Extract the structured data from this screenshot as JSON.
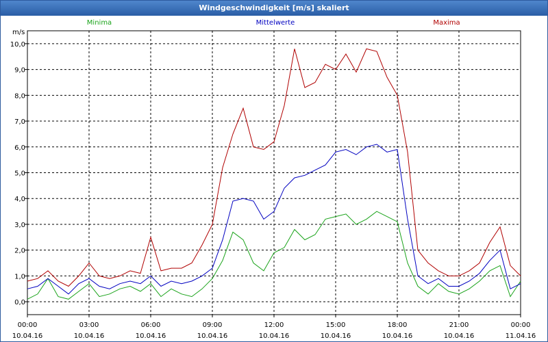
{
  "window": {
    "title": "Windgeschwindigkeit [m/s] skaliert"
  },
  "chart_data": {
    "type": "line",
    "title": "Windgeschwindigkeit [m/s] skaliert",
    "ylabel": "m/s",
    "xlabel": "",
    "ylim": [
      -0.5,
      10.5
    ],
    "xlim": [
      0,
      24
    ],
    "grid": true,
    "legend_placement": "top",
    "yticks": [
      {
        "value": 0,
        "label": "0,0"
      },
      {
        "value": 1,
        "label": "1,0"
      },
      {
        "value": 2,
        "label": "2,0"
      },
      {
        "value": 3,
        "label": "3,0"
      },
      {
        "value": 4,
        "label": "4,0"
      },
      {
        "value": 5,
        "label": "5,0"
      },
      {
        "value": 6,
        "label": "6,0"
      },
      {
        "value": 7,
        "label": "7,0"
      },
      {
        "value": 8,
        "label": "8,0"
      },
      {
        "value": 9,
        "label": "9,0"
      },
      {
        "value": 10,
        "label": "10,0"
      }
    ],
    "xticks": [
      {
        "value": 0,
        "time": "00:00",
        "date": "10.04.16"
      },
      {
        "value": 3,
        "time": "03:00",
        "date": "10.04.16"
      },
      {
        "value": 6,
        "time": "06:00",
        "date": "10.04.16"
      },
      {
        "value": 9,
        "time": "09:00",
        "date": "10.04.16"
      },
      {
        "value": 12,
        "time": "12:00",
        "date": "10.04.16"
      },
      {
        "value": 15,
        "time": "15:00",
        "date": "10.04.16"
      },
      {
        "value": 18,
        "time": "18:00",
        "date": "10.04.16"
      },
      {
        "value": 21,
        "time": "21:00",
        "date": "10.04.16"
      },
      {
        "value": 24,
        "time": "00:00",
        "date": "11.04.16"
      }
    ],
    "series": [
      {
        "name": "Minima",
        "color": "#1aa31a",
        "x": [
          0,
          0.5,
          1,
          1.5,
          2,
          2.5,
          3,
          3.5,
          4,
          4.5,
          5,
          5.5,
          6,
          6.5,
          7,
          7.5,
          8,
          8.5,
          9,
          9.5,
          10,
          10.5,
          11,
          11.5,
          12,
          12.5,
          13,
          13.5,
          14,
          14.5,
          15,
          15.5,
          16,
          16.5,
          17,
          17.5,
          18,
          18.5,
          19,
          19.5,
          20,
          20.5,
          21,
          21.5,
          22,
          22.5,
          23,
          23.5,
          24
        ],
        "values": [
          0.1,
          0.3,
          0.9,
          0.2,
          0.1,
          0.4,
          0.7,
          0.2,
          0.3,
          0.5,
          0.6,
          0.4,
          0.7,
          0.2,
          0.5,
          0.3,
          0.2,
          0.5,
          0.9,
          1.6,
          2.7,
          2.4,
          1.5,
          1.2,
          1.9,
          2.1,
          2.8,
          2.4,
          2.6,
          3.2,
          3.3,
          3.4,
          3.0,
          3.2,
          3.5,
          3.3,
          3.1,
          1.5,
          0.6,
          0.3,
          0.7,
          0.4,
          0.3,
          0.5,
          0.8,
          1.2,
          1.4,
          0.2,
          0.8
        ]
      },
      {
        "name": "Mittelwerte",
        "color": "#0000c0",
        "x": [
          0,
          0.5,
          1,
          1.5,
          2,
          2.5,
          3,
          3.5,
          4,
          4.5,
          5,
          5.5,
          6,
          6.5,
          7,
          7.5,
          8,
          8.5,
          9,
          9.5,
          10,
          10.5,
          11,
          11.5,
          12,
          12.5,
          13,
          13.5,
          14,
          14.5,
          15,
          15.5,
          16,
          16.5,
          17,
          17.5,
          18,
          18.5,
          19,
          19.5,
          20,
          20.5,
          21,
          21.5,
          22,
          22.5,
          23,
          23.5,
          24
        ],
        "values": [
          0.5,
          0.6,
          0.9,
          0.6,
          0.3,
          0.7,
          0.9,
          0.6,
          0.5,
          0.7,
          0.8,
          0.7,
          1.0,
          0.6,
          0.8,
          0.7,
          0.8,
          1.0,
          1.3,
          2.4,
          3.9,
          4.0,
          3.9,
          3.2,
          3.5,
          4.4,
          4.8,
          4.9,
          5.1,
          5.3,
          5.8,
          5.9,
          5.7,
          6.0,
          6.1,
          5.8,
          5.9,
          3.2,
          1.0,
          0.7,
          0.9,
          0.6,
          0.6,
          0.8,
          1.1,
          1.6,
          2.0,
          0.5,
          0.7
        ]
      },
      {
        "name": "Maxima",
        "color": "#b00000",
        "x": [
          0,
          0.5,
          1,
          1.5,
          2,
          2.5,
          3,
          3.5,
          4,
          4.5,
          5,
          5.5,
          6,
          6.5,
          7,
          7.5,
          8,
          8.5,
          9,
          9.5,
          10,
          10.5,
          11,
          11.5,
          12,
          12.5,
          13,
          13.5,
          14,
          14.5,
          15,
          15.5,
          16,
          16.5,
          17,
          17.5,
          18,
          18.5,
          19,
          19.5,
          20,
          20.5,
          21,
          21.5,
          22,
          22.5,
          23,
          23.5,
          24
        ],
        "values": [
          0.8,
          0.9,
          1.2,
          0.8,
          0.6,
          1.0,
          1.5,
          1.0,
          0.9,
          1.0,
          1.2,
          1.1,
          2.5,
          1.2,
          1.3,
          1.3,
          1.5,
          2.2,
          3.0,
          5.2,
          6.5,
          7.5,
          6.0,
          5.9,
          6.2,
          7.6,
          9.8,
          8.3,
          8.5,
          9.2,
          9.0,
          9.6,
          8.9,
          9.8,
          9.7,
          8.7,
          8.0,
          5.8,
          2.0,
          1.5,
          1.2,
          1.0,
          1.0,
          1.2,
          1.5,
          2.3,
          2.9,
          1.4,
          1.0
        ]
      }
    ]
  }
}
